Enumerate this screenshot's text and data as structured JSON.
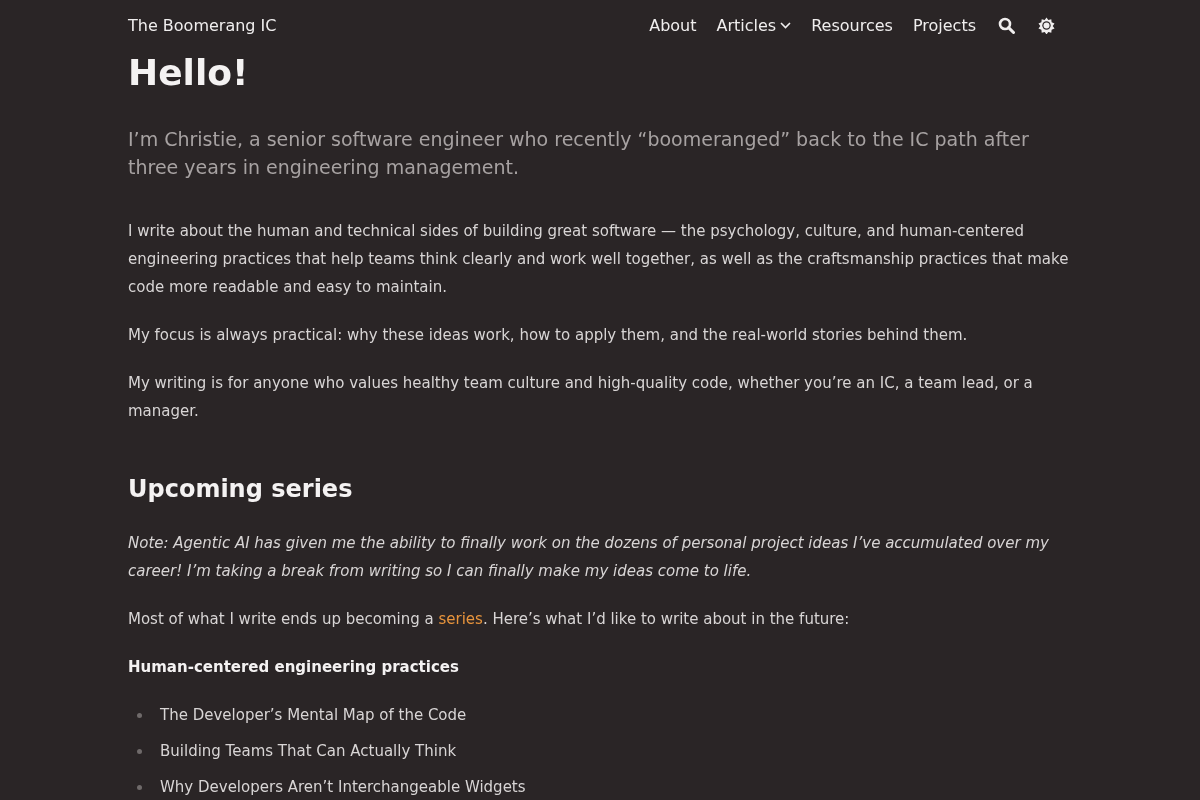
{
  "header": {
    "site_title": "The Boomerang IC",
    "nav": [
      {
        "label": "About",
        "kind": "link"
      },
      {
        "label": "Articles",
        "kind": "dropdown"
      },
      {
        "label": "Resources",
        "kind": "link"
      },
      {
        "label": "Projects",
        "kind": "link"
      }
    ]
  },
  "intro": {
    "title": "Hello!",
    "lead": "I’m Christie, a senior software engineer who recently “boomeranged” back to the IC path after three years in engineering management.",
    "paragraphs": [
      "I write about the human and technical sides of building great software — the psychology, culture, and human-centered engineering practices that help teams think clearly and work well together, as well as the craftsmanship practices that make code more readable and easy to maintain.",
      "My focus is always practical: why these ideas work, how to apply them, and the real-world stories behind them.",
      "My writing is for anyone who values healthy team culture and high-quality code, whether you’re an IC, a team lead, or a manager."
    ]
  },
  "upcoming": {
    "heading": "Upcoming series",
    "note": "Note: Agentic AI has given me the ability to finally work on the dozens of personal project ideas I’ve accumulated over my career! I’m taking a break from writing so I can finally make my ideas come to life.",
    "paragraph": [
      {
        "kind": "text",
        "text": "Most of what I write ends up becoming a "
      },
      {
        "kind": "link",
        "text": "series"
      },
      {
        "kind": "text",
        "text": ". Here’s what I’d like to write about in the future:"
      }
    ],
    "groups": [
      {
        "title": "Human-centered engineering practices",
        "items": [
          "The Developer’s Mental Map of the Code",
          "Building Teams That Can Actually Think",
          "Why Developers Aren’t Interchangeable Widgets"
        ]
      }
    ]
  }
}
